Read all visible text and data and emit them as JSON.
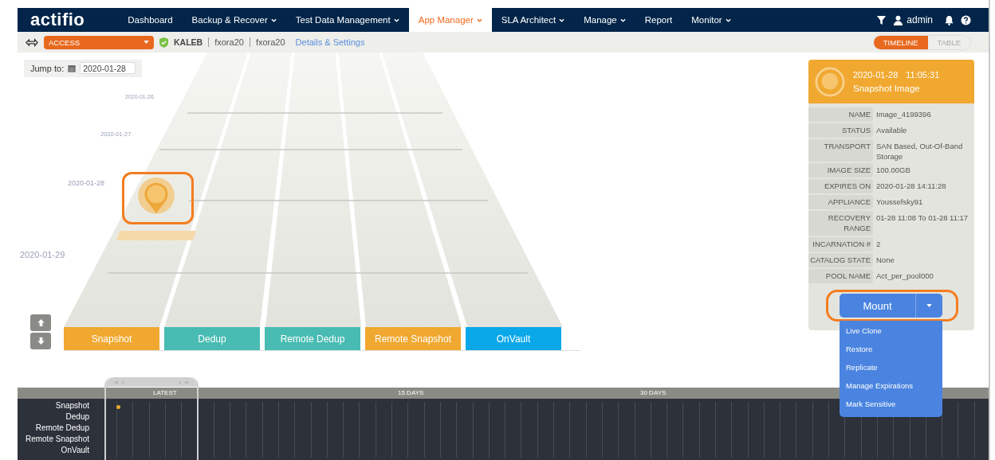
{
  "nav": {
    "logo": "actifio",
    "items": [
      {
        "label": "Dashboard",
        "has_menu": false,
        "selected": false
      },
      {
        "label": "Backup & Recover",
        "has_menu": true,
        "selected": false
      },
      {
        "label": "Test Data Management",
        "has_menu": true,
        "selected": false
      },
      {
        "label": "App Manager",
        "has_menu": true,
        "selected": true
      },
      {
        "label": "SLA Architect",
        "has_menu": true,
        "selected": false
      },
      {
        "label": "Manage",
        "has_menu": true,
        "selected": false
      },
      {
        "label": "Report",
        "has_menu": false,
        "selected": false
      },
      {
        "label": "Monitor",
        "has_menu": true,
        "selected": false
      }
    ],
    "user": "admin"
  },
  "subbar": {
    "mode": "ACCESS",
    "app": "KALEB",
    "crumbs": [
      "fxora20",
      "fxora20"
    ],
    "link": "Details & Settings",
    "views": [
      {
        "label": "TIMELINE",
        "selected": true
      },
      {
        "label": "TABLE",
        "selected": false
      }
    ]
  },
  "jump_to": {
    "label": "Jump to:",
    "value": "2020-01-28"
  },
  "date_labels": [
    "2020-01-26",
    "2020-01-27",
    "2020-01-28",
    "2020-01-29"
  ],
  "lanes": [
    {
      "label": "Snapshot",
      "color": "#f0a830"
    },
    {
      "label": "Dedup",
      "color": "#48bcb2"
    },
    {
      "label": "Remote Dedup",
      "color": "#48bcb2"
    },
    {
      "label": "Remote Snapshot",
      "color": "#f0a830"
    },
    {
      "label": "OnVault",
      "color": "#0aa8e8"
    }
  ],
  "details": {
    "date": "2020-01-28",
    "time": "11:05:31",
    "type": "Snapshot Image",
    "fields": [
      {
        "label": "NAME",
        "value": "Image_4199396"
      },
      {
        "label": "STATUS",
        "value": "Available"
      },
      {
        "label": "TRANSPORT",
        "value": "SAN Based, Out-Of-Band Storage"
      },
      {
        "label": "IMAGE SIZE",
        "value": "100.00GB"
      },
      {
        "label": "EXPIRES ON",
        "value": "2020-01-28 14:11:28"
      },
      {
        "label": "APPLIANCE",
        "value": "Youssefsky91"
      },
      {
        "label": "RECOVERY RANGE",
        "value": "01-28 11:08 To 01-28 11:17"
      },
      {
        "label": "INCARNATION #",
        "value": "2"
      },
      {
        "label": "CATALOG STATE",
        "value": "None"
      },
      {
        "label": "POOL NAME",
        "value": "Act_per_pool000"
      }
    ],
    "action": "Mount",
    "menu": [
      "Live Clone",
      "Restore",
      "Replicate",
      "Manage Expirations",
      "Mark Sensitive"
    ]
  },
  "timeline": {
    "rows": [
      "Snapshot",
      "Dedup",
      "Remote Dedup",
      "Remote Snapshot",
      "OnVault"
    ],
    "markers": [
      "LATEST",
      "15 DAYS",
      "30 DAYS"
    ]
  }
}
